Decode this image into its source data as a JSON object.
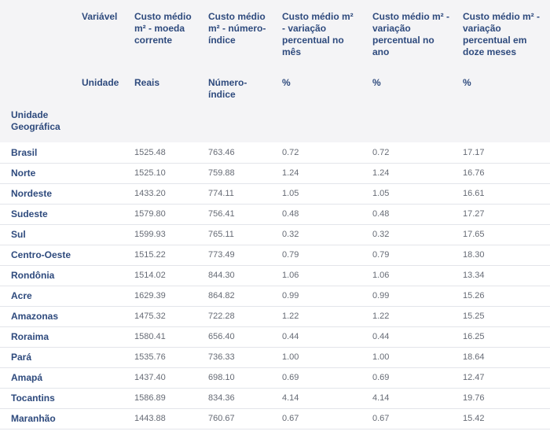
{
  "header": {
    "variavel_label": "Variável",
    "unidade_label": "Unidade",
    "unidade_geografica_label": "Unidade Geográfica",
    "columns": [
      {
        "title": "Custo médio m² - moeda corrente",
        "unit": "Reais"
      },
      {
        "title": "Custo médio m² - número-índice",
        "unit": "Número-índice"
      },
      {
        "title": "Custo médio m² - variação percentual no mês",
        "unit": "%"
      },
      {
        "title": "Custo médio m² - variação percentual no ano",
        "unit": "%"
      },
      {
        "title": "Custo médio m² - variação percentual em doze meses",
        "unit": "%"
      }
    ]
  },
  "rows": [
    {
      "name": "Brasil",
      "v": [
        "1525.48",
        "763.46",
        "0.72",
        "0.72",
        "17.17"
      ]
    },
    {
      "name": "Norte",
      "v": [
        "1525.10",
        "759.88",
        "1.24",
        "1.24",
        "16.76"
      ]
    },
    {
      "name": "Nordeste",
      "v": [
        "1433.20",
        "774.11",
        "1.05",
        "1.05",
        "16.61"
      ]
    },
    {
      "name": "Sudeste",
      "v": [
        "1579.80",
        "756.41",
        "0.48",
        "0.48",
        "17.27"
      ]
    },
    {
      "name": "Sul",
      "v": [
        "1599.93",
        "765.11",
        "0.32",
        "0.32",
        "17.65"
      ]
    },
    {
      "name": "Centro-Oeste",
      "v": [
        "1515.22",
        "773.49",
        "0.79",
        "0.79",
        "18.30"
      ]
    },
    {
      "name": "Rondônia",
      "v": [
        "1514.02",
        "844.30",
        "1.06",
        "1.06",
        "13.34"
      ]
    },
    {
      "name": "Acre",
      "v": [
        "1629.39",
        "864.82",
        "0.99",
        "0.99",
        "15.26"
      ]
    },
    {
      "name": "Amazonas",
      "v": [
        "1475.32",
        "722.28",
        "1.22",
        "1.22",
        "15.25"
      ]
    },
    {
      "name": "Roraima",
      "v": [
        "1580.41",
        "656.40",
        "0.44",
        "0.44",
        "16.25"
      ]
    },
    {
      "name": "Pará",
      "v": [
        "1535.76",
        "736.33",
        "1.00",
        "1.00",
        "18.64"
      ]
    },
    {
      "name": "Amapá",
      "v": [
        "1437.40",
        "698.10",
        "0.69",
        "0.69",
        "12.47"
      ]
    },
    {
      "name": "Tocantins",
      "v": [
        "1586.89",
        "834.36",
        "4.14",
        "4.14",
        "19.76"
      ]
    },
    {
      "name": "Maranhão",
      "v": [
        "1443.88",
        "760.67",
        "0.67",
        "0.67",
        "15.42"
      ]
    }
  ],
  "colors": {
    "header_bg": "#f4f4f6",
    "header_text": "#2e4a7d",
    "cell_text": "#666b75",
    "row_border": "#e3e5ea"
  }
}
